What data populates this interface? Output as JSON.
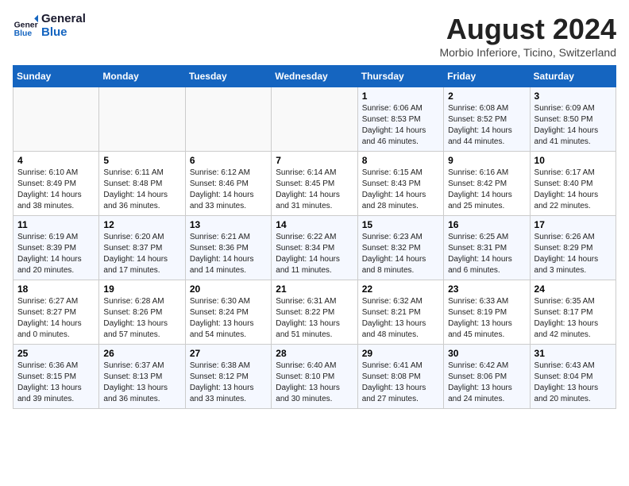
{
  "logo": {
    "line1": "General",
    "line2": "Blue"
  },
  "title": "August 2024",
  "subtitle": "Morbio Inferiore, Ticino, Switzerland",
  "weekdays": [
    "Sunday",
    "Monday",
    "Tuesday",
    "Wednesday",
    "Thursday",
    "Friday",
    "Saturday"
  ],
  "weeks": [
    [
      {
        "day": "",
        "info": ""
      },
      {
        "day": "",
        "info": ""
      },
      {
        "day": "",
        "info": ""
      },
      {
        "day": "",
        "info": ""
      },
      {
        "day": "1",
        "info": "Sunrise: 6:06 AM\nSunset: 8:53 PM\nDaylight: 14 hours\nand 46 minutes."
      },
      {
        "day": "2",
        "info": "Sunrise: 6:08 AM\nSunset: 8:52 PM\nDaylight: 14 hours\nand 44 minutes."
      },
      {
        "day": "3",
        "info": "Sunrise: 6:09 AM\nSunset: 8:50 PM\nDaylight: 14 hours\nand 41 minutes."
      }
    ],
    [
      {
        "day": "4",
        "info": "Sunrise: 6:10 AM\nSunset: 8:49 PM\nDaylight: 14 hours\nand 38 minutes."
      },
      {
        "day": "5",
        "info": "Sunrise: 6:11 AM\nSunset: 8:48 PM\nDaylight: 14 hours\nand 36 minutes."
      },
      {
        "day": "6",
        "info": "Sunrise: 6:12 AM\nSunset: 8:46 PM\nDaylight: 14 hours\nand 33 minutes."
      },
      {
        "day": "7",
        "info": "Sunrise: 6:14 AM\nSunset: 8:45 PM\nDaylight: 14 hours\nand 31 minutes."
      },
      {
        "day": "8",
        "info": "Sunrise: 6:15 AM\nSunset: 8:43 PM\nDaylight: 14 hours\nand 28 minutes."
      },
      {
        "day": "9",
        "info": "Sunrise: 6:16 AM\nSunset: 8:42 PM\nDaylight: 14 hours\nand 25 minutes."
      },
      {
        "day": "10",
        "info": "Sunrise: 6:17 AM\nSunset: 8:40 PM\nDaylight: 14 hours\nand 22 minutes."
      }
    ],
    [
      {
        "day": "11",
        "info": "Sunrise: 6:19 AM\nSunset: 8:39 PM\nDaylight: 14 hours\nand 20 minutes."
      },
      {
        "day": "12",
        "info": "Sunrise: 6:20 AM\nSunset: 8:37 PM\nDaylight: 14 hours\nand 17 minutes."
      },
      {
        "day": "13",
        "info": "Sunrise: 6:21 AM\nSunset: 8:36 PM\nDaylight: 14 hours\nand 14 minutes."
      },
      {
        "day": "14",
        "info": "Sunrise: 6:22 AM\nSunset: 8:34 PM\nDaylight: 14 hours\nand 11 minutes."
      },
      {
        "day": "15",
        "info": "Sunrise: 6:23 AM\nSunset: 8:32 PM\nDaylight: 14 hours\nand 8 minutes."
      },
      {
        "day": "16",
        "info": "Sunrise: 6:25 AM\nSunset: 8:31 PM\nDaylight: 14 hours\nand 6 minutes."
      },
      {
        "day": "17",
        "info": "Sunrise: 6:26 AM\nSunset: 8:29 PM\nDaylight: 14 hours\nand 3 minutes."
      }
    ],
    [
      {
        "day": "18",
        "info": "Sunrise: 6:27 AM\nSunset: 8:27 PM\nDaylight: 14 hours\nand 0 minutes."
      },
      {
        "day": "19",
        "info": "Sunrise: 6:28 AM\nSunset: 8:26 PM\nDaylight: 13 hours\nand 57 minutes."
      },
      {
        "day": "20",
        "info": "Sunrise: 6:30 AM\nSunset: 8:24 PM\nDaylight: 13 hours\nand 54 minutes."
      },
      {
        "day": "21",
        "info": "Sunrise: 6:31 AM\nSunset: 8:22 PM\nDaylight: 13 hours\nand 51 minutes."
      },
      {
        "day": "22",
        "info": "Sunrise: 6:32 AM\nSunset: 8:21 PM\nDaylight: 13 hours\nand 48 minutes."
      },
      {
        "day": "23",
        "info": "Sunrise: 6:33 AM\nSunset: 8:19 PM\nDaylight: 13 hours\nand 45 minutes."
      },
      {
        "day": "24",
        "info": "Sunrise: 6:35 AM\nSunset: 8:17 PM\nDaylight: 13 hours\nand 42 minutes."
      }
    ],
    [
      {
        "day": "25",
        "info": "Sunrise: 6:36 AM\nSunset: 8:15 PM\nDaylight: 13 hours\nand 39 minutes."
      },
      {
        "day": "26",
        "info": "Sunrise: 6:37 AM\nSunset: 8:13 PM\nDaylight: 13 hours\nand 36 minutes."
      },
      {
        "day": "27",
        "info": "Sunrise: 6:38 AM\nSunset: 8:12 PM\nDaylight: 13 hours\nand 33 minutes."
      },
      {
        "day": "28",
        "info": "Sunrise: 6:40 AM\nSunset: 8:10 PM\nDaylight: 13 hours\nand 30 minutes."
      },
      {
        "day": "29",
        "info": "Sunrise: 6:41 AM\nSunset: 8:08 PM\nDaylight: 13 hours\nand 27 minutes."
      },
      {
        "day": "30",
        "info": "Sunrise: 6:42 AM\nSunset: 8:06 PM\nDaylight: 13 hours\nand 24 minutes."
      },
      {
        "day": "31",
        "info": "Sunrise: 6:43 AM\nSunset: 8:04 PM\nDaylight: 13 hours\nand 20 minutes."
      }
    ]
  ]
}
